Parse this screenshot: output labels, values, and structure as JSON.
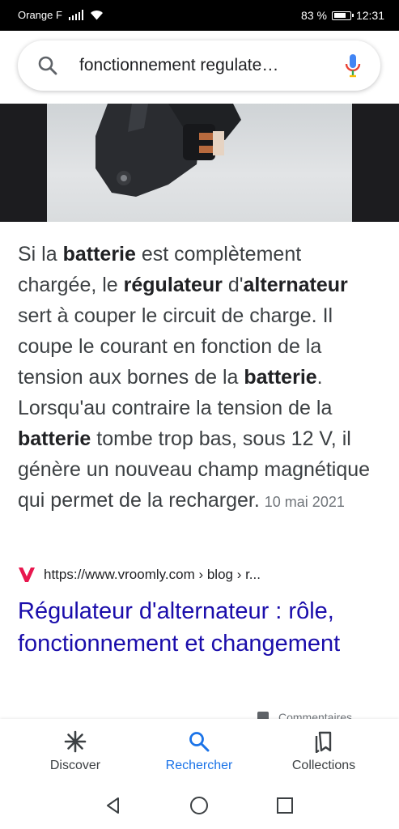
{
  "status_bar": {
    "carrier": "Orange F",
    "battery_percent": "83 %",
    "time": "12:31"
  },
  "search": {
    "query": "fonctionnement regulate…"
  },
  "snippet": {
    "parts": [
      {
        "text": "Si la ",
        "bold": false
      },
      {
        "text": "batterie",
        "bold": true
      },
      {
        "text": " est complètement chargée, le ",
        "bold": false
      },
      {
        "text": "régulateur",
        "bold": true
      },
      {
        "text": " d'",
        "bold": false
      },
      {
        "text": "alternateur",
        "bold": true
      },
      {
        "text": " sert à couper le circuit de charge. Il coupe le courant en fonction de la tension aux bornes de la ",
        "bold": false
      },
      {
        "text": "batterie",
        "bold": true
      },
      {
        "text": ". Lorsqu'au contraire la tension de la ",
        "bold": false
      },
      {
        "text": "batterie",
        "bold": true
      },
      {
        "text": " tombe trop bas, sous 12 V, il génère un nouveau champ magnétique qui permet de la recharger.",
        "bold": false
      }
    ],
    "date": "10 mai 2021"
  },
  "result": {
    "favicon_letter": "V",
    "url": "https://www.vroomly.com › blog › r...",
    "title": "Régulateur d'alternateur : rôle, fonctionnement et changement"
  },
  "peek_label": "Commentaires",
  "bottom_nav": {
    "items": [
      {
        "label": "Discover",
        "icon": "asterisk-icon",
        "active": false
      },
      {
        "label": "Rechercher",
        "icon": "search-icon",
        "active": true
      },
      {
        "label": "Collections",
        "icon": "bookmarks-icon",
        "active": false
      }
    ]
  },
  "colors": {
    "link": "#1a0dab",
    "active": "#1a73e8",
    "favicon": "#e8174e"
  }
}
